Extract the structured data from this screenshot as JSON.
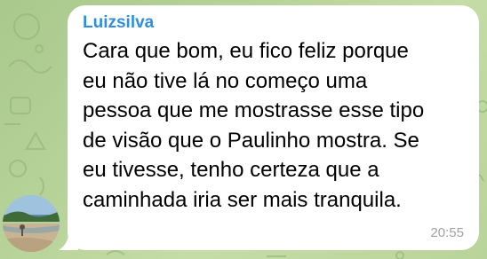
{
  "message": {
    "sender": "Luizsilva",
    "lines": [
      "Cara que bom, eu fico feliz porque",
      "eu não tive lá no começo uma",
      "pessoa que me mostrasse esse tipo",
      "de visão que o Paulinho mostra. Se",
      "eu tivesse, tenho certeza que a",
      "caminhada iria ser mais tranquila."
    ],
    "time": "20:55"
  },
  "colors": {
    "sender_name": "#2f8ee0",
    "bubble": "#ffffff",
    "timestamp": "#a2a2a2",
    "background": "#b7d39a"
  },
  "icons": {
    "background_pattern": "doodle-pattern",
    "avatar": "beach-photo-avatar"
  }
}
